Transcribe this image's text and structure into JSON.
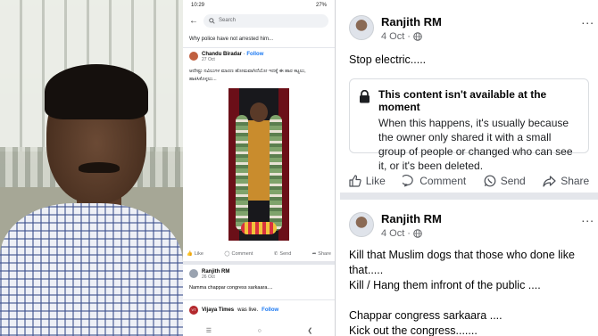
{
  "phone": {
    "status_time": "10:29",
    "status_right": "27%",
    "search_placeholder": "Search",
    "card_title": "Why police have not arrested him...",
    "post": {
      "author": "Chandu Biradar",
      "follow": "Follow",
      "date": "27 Oct",
      "text": "ಆದೇಷ್ಟು ನವಿಲುಗಳ ಮಾರಣ ಹೋಮವಾಗಿದೆಯೋ ಇದಕ್ಕೆ ಈ ಹಾರ ಕಟ್ಟಲು, ಹಾಕಿಸಿಕೊಳ್ಳಲು..."
    },
    "actions": {
      "like": "Like",
      "comment": "Comment",
      "send": "Send",
      "share": "Share"
    },
    "comment": {
      "author": "Ranjith RM",
      "date": "26 Oct",
      "text": "Namma chappar congress sarkaara...."
    },
    "share_row": {
      "page_name": "Vijaya Times",
      "suffix": "was live.",
      "follow": "Follow",
      "logo_text": "VT"
    }
  },
  "feed": {
    "post1": {
      "author": "Ranjith RM",
      "date": "4 Oct",
      "text": "Stop electric.....",
      "notice_title": "This content isn't available at the moment",
      "notice_body": "When this happens, it's usually because the owner only shared it with a small group of people or changed who can see it, or it's been deleted."
    },
    "post2": {
      "author": "Ranjith RM",
      "date": "4 Oct",
      "text": "Kill that Muslim dogs that those who done like that.....\nKill / Hang them infront of the public ....\n\nChappar congress  sarkaara ....\nKick out the congress......."
    },
    "actions": {
      "like": "Like",
      "comment": "Comment",
      "send": "Send",
      "share": "Share"
    },
    "more_menu": "..."
  },
  "colors": {
    "fb_blue": "#1877f2",
    "divider": "#e4e6eb",
    "secondary_text": "#65676b"
  },
  "icons": [
    "back-arrow-icon",
    "search-icon",
    "lock-icon",
    "globe-icon",
    "like-icon",
    "comment-icon",
    "whatsapp-send-icon",
    "share-icon",
    "more-dots-icon"
  ]
}
